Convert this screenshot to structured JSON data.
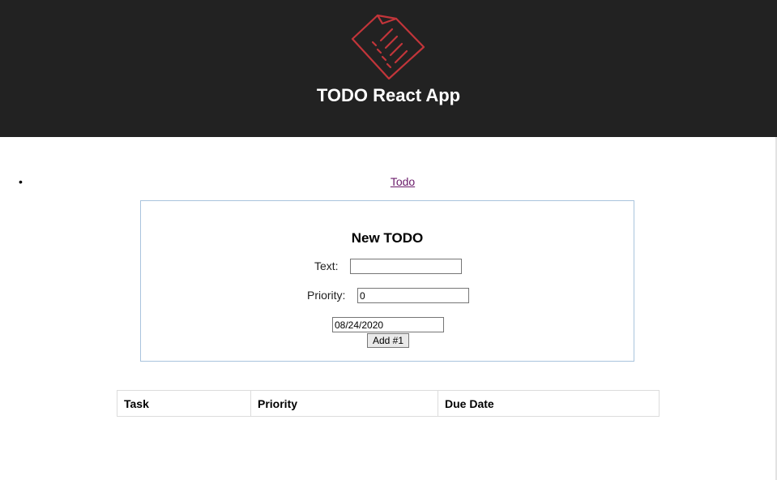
{
  "header": {
    "title": "TODO React App",
    "logo_icon": "checklist-document-icon",
    "background": "#222222",
    "logo_color": "#c2353a"
  },
  "nav": {
    "items": [
      {
        "label": "Todo"
      }
    ]
  },
  "form": {
    "title": "New TODO",
    "text_label": "Text:",
    "text_value": "",
    "priority_label": "Priority:",
    "priority_value": "0",
    "date_value": "08/24/2020",
    "add_button_label": "Add #1"
  },
  "table": {
    "columns": [
      "Task",
      "Priority",
      "Due Date"
    ],
    "rows": []
  }
}
